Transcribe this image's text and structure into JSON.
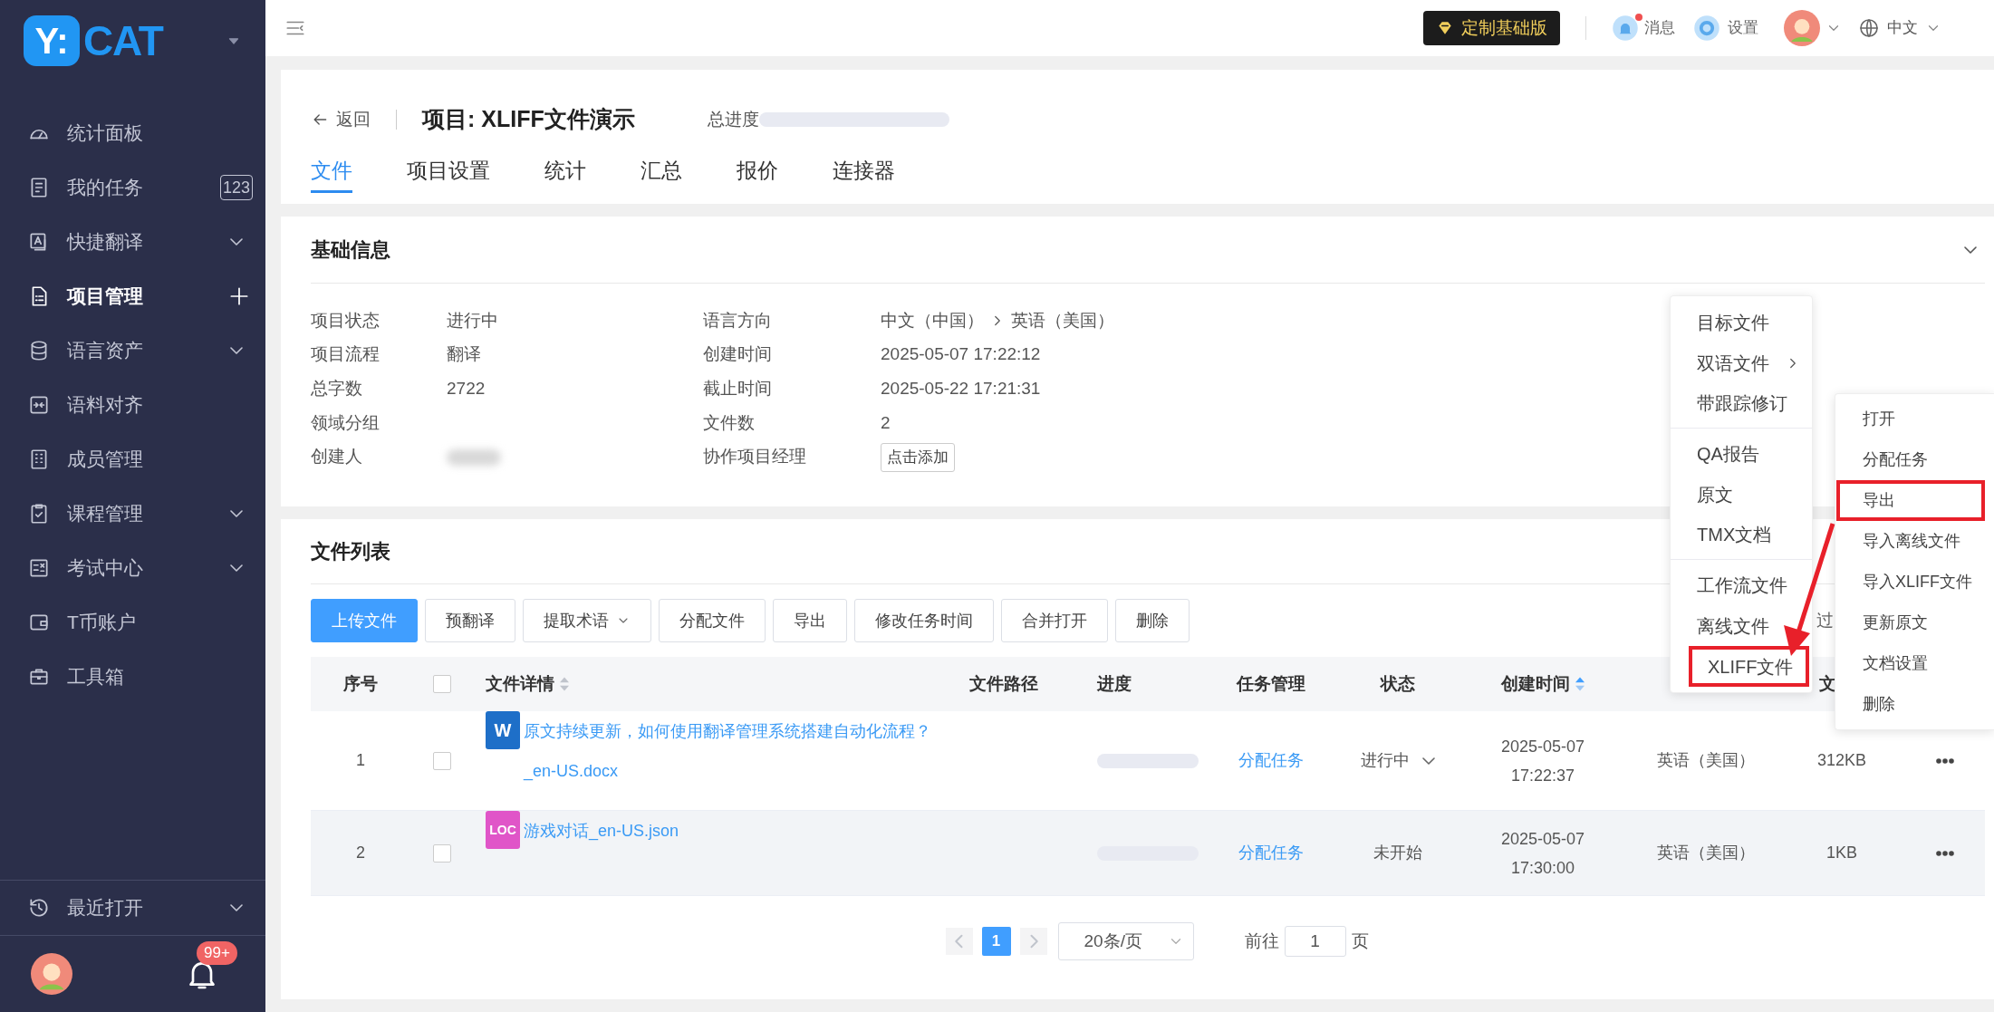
{
  "sidebar": {
    "logo": {
      "mark": "Y:",
      "text": "CAT"
    },
    "items": [
      {
        "label": "统计面板",
        "kind": "plain",
        "selected": false
      },
      {
        "label": "我的任务",
        "kind": "badge",
        "badge": "123",
        "selected": false
      },
      {
        "label": "快捷翻译",
        "kind": "group",
        "expanded": false,
        "selected": false
      },
      {
        "label": "项目管理",
        "kind": "add",
        "selected": true
      },
      {
        "label": "语言资产",
        "kind": "group",
        "expanded": false,
        "selected": false
      },
      {
        "label": "语料对齐",
        "kind": "plain",
        "selected": false
      },
      {
        "label": "成员管理",
        "kind": "plain",
        "selected": false
      },
      {
        "label": "课程管理",
        "kind": "group",
        "expanded": false,
        "selected": false
      },
      {
        "label": "考试中心",
        "kind": "group",
        "expanded": false,
        "selected": false
      },
      {
        "label": "T币账户",
        "kind": "plain",
        "selected": false
      },
      {
        "label": "工具箱",
        "kind": "plain",
        "selected": false
      }
    ],
    "recent": {
      "label": "最近打开",
      "expanded": false
    },
    "notifications_badge": "99+"
  },
  "header": {
    "plan": "定制基础版",
    "messages": {
      "label": "消息",
      "unread": true
    },
    "settings": "设置",
    "language": "中文"
  },
  "project": {
    "back": "返回",
    "title": "项目: XLIFF文件演示",
    "progress_label": "总进度",
    "progress": {
      "level": 0
    },
    "tabs": [
      {
        "label": "文件",
        "selected": true
      },
      {
        "label": "项目设置",
        "selected": false
      },
      {
        "label": "统计",
        "selected": false
      },
      {
        "label": "汇总",
        "selected": false
      },
      {
        "label": "报价",
        "selected": false
      },
      {
        "label": "连接器",
        "selected": false
      }
    ]
  },
  "basic_info": {
    "title": "基础信息",
    "expanded": true,
    "left": [
      {
        "label": "项目状态",
        "value": "进行中"
      },
      {
        "label": "项目流程",
        "value": "翻译"
      },
      {
        "label": "总字数",
        "value": "2722"
      },
      {
        "label": "领域分组"
      },
      {
        "label": "创建人",
        "redacted": true
      }
    ],
    "right": [
      {
        "label": "语言方向",
        "value": "中文（中国）",
        "target": "英语（美国）"
      },
      {
        "label": "创建时间",
        "value": "2025-05-07 17:22:12"
      },
      {
        "label": "截止时间",
        "value": "2025-05-22 17:21:31"
      },
      {
        "label": "文件数",
        "value": "2"
      },
      {
        "label": "协作项目经理",
        "button": "点击添加"
      }
    ]
  },
  "file_list": {
    "title": "文件列表",
    "toolbar": [
      {
        "label": "上传文件",
        "kind": "primary"
      },
      {
        "label": "预翻译",
        "kind": "plain"
      },
      {
        "label": "提取术语",
        "kind": "dropdown"
      },
      {
        "label": "分配文件",
        "kind": "plain"
      },
      {
        "label": "导出",
        "kind": "plain"
      },
      {
        "label": "修改任务时间",
        "kind": "plain"
      },
      {
        "label": "合并打开",
        "kind": "plain"
      },
      {
        "label": "删除",
        "kind": "plain"
      }
    ],
    "toolbar_partial": "过",
    "columns": [
      {
        "kind": "text",
        "label": "序号"
      },
      {
        "kind": "checkbox",
        "checked": false
      },
      {
        "kind": "text",
        "label": "文件详情",
        "sorted": false
      },
      {
        "kind": "text",
        "label": "文件路径"
      },
      {
        "kind": "text",
        "label": "进度"
      },
      {
        "kind": "text",
        "label": "任务管理"
      },
      {
        "kind": "text",
        "label": "状态"
      },
      {
        "kind": "text",
        "label": "创建时间",
        "sorted": true
      },
      {
        "kind": "text",
        "label": "文"
      }
    ],
    "rows": [
      {
        "number": "1",
        "checked": false,
        "file": {
          "kind": "word",
          "icon_label": "W",
          "name": "原文持续更新，如何使用翻译管理系统搭建自动化流程？_en-US.docx"
        },
        "progress": {
          "level": 0
        },
        "task": "分配任务",
        "status": {
          "label": "进行中",
          "dropdown": true
        },
        "created_date": "2025-05-07",
        "created_time": "17:22:37",
        "target": "英语（美国）",
        "size": "312KB",
        "hover": false
      },
      {
        "number": "2",
        "checked": false,
        "file": {
          "kind": "loc",
          "icon_label": "LOC",
          "name": "游戏对话_en-US.json"
        },
        "progress": {
          "level": 0
        },
        "task": "分配任务",
        "status": {
          "label": "未开始",
          "dropdown": false
        },
        "created_date": "2025-05-07",
        "created_time": "17:30:00",
        "target": "英语（美国）",
        "size": "1KB",
        "hover": true
      }
    ],
    "pagination": {
      "pages": [
        {
          "label": "1",
          "selected": true
        }
      ],
      "page_size": "20条/页",
      "goto_label": "前往",
      "goto_value": "1",
      "page_unit": "页"
    }
  },
  "export_menu": {
    "items": [
      {
        "label": "目标文件",
        "submenu": false,
        "highlighted": false,
        "divider_after": false
      },
      {
        "label": "双语文件",
        "submenu": true,
        "highlighted": false,
        "divider_after": false
      },
      {
        "label": "带跟踪修订",
        "submenu": false,
        "highlighted": false,
        "divider_after": true
      },
      {
        "label": "QA报告",
        "submenu": false,
        "highlighted": false,
        "divider_after": false
      },
      {
        "label": "原文",
        "submenu": false,
        "highlighted": false,
        "divider_after": false
      },
      {
        "label": "TMX文档",
        "submenu": false,
        "highlighted": false,
        "divider_after": true
      },
      {
        "label": "工作流文件",
        "submenu": false,
        "highlighted": false,
        "divider_after": false
      },
      {
        "label": "离线文件",
        "submenu": false,
        "highlighted": false,
        "divider_after": false
      },
      {
        "label": "XLIFF文件",
        "submenu": false,
        "highlighted": true,
        "divider_after": false
      }
    ]
  },
  "row_menu": {
    "items": [
      {
        "label": "打开",
        "highlighted": false
      },
      {
        "label": "分配任务",
        "highlighted": false
      },
      {
        "label": "导出",
        "highlighted": true
      },
      {
        "label": "导入离线文件",
        "highlighted": false
      },
      {
        "label": "导入XLIFF文件",
        "highlighted": false
      },
      {
        "label": "更新原文",
        "highlighted": false
      },
      {
        "label": "文档设置",
        "highlighted": false
      },
      {
        "label": "删除",
        "highlighted": false
      }
    ]
  }
}
